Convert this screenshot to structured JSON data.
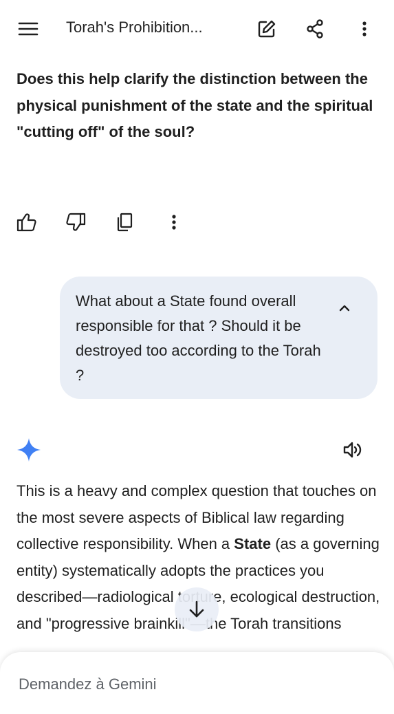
{
  "header": {
    "title": "Torah's Prohibition...",
    "icons": [
      "menu-icon",
      "edit-icon",
      "share-icon",
      "more-vert-icon"
    ]
  },
  "previous_response": {
    "closing_question": "Does this help clarify the distinction between the physical punishment of the state and the spiritual \"cutting off\" of the soul?",
    "actions": [
      "thumbs-up-icon",
      "thumbs-down-icon",
      "copy-icon",
      "more-vert-icon"
    ]
  },
  "user_message": {
    "text": "What about a State found overall responsible for that ? Should it be destroyed too according to the Torah ?"
  },
  "response": {
    "part1": "This is a heavy and complex question that touches on the most severe aspects of Biblical law regarding collective responsibility. When a ",
    "bold": "State",
    "part2": " (as a governing entity) systematically adopts the practices you described—radiological torture, ecological destruction, and \"progressive brainkill\"—the Torah transitions"
  },
  "composer": {
    "placeholder": "Demandez à Gemini"
  },
  "colors": {
    "accent_blue": "#4285f4",
    "bubble_bg": "#e9eef6",
    "text": "#1f1f1f"
  }
}
